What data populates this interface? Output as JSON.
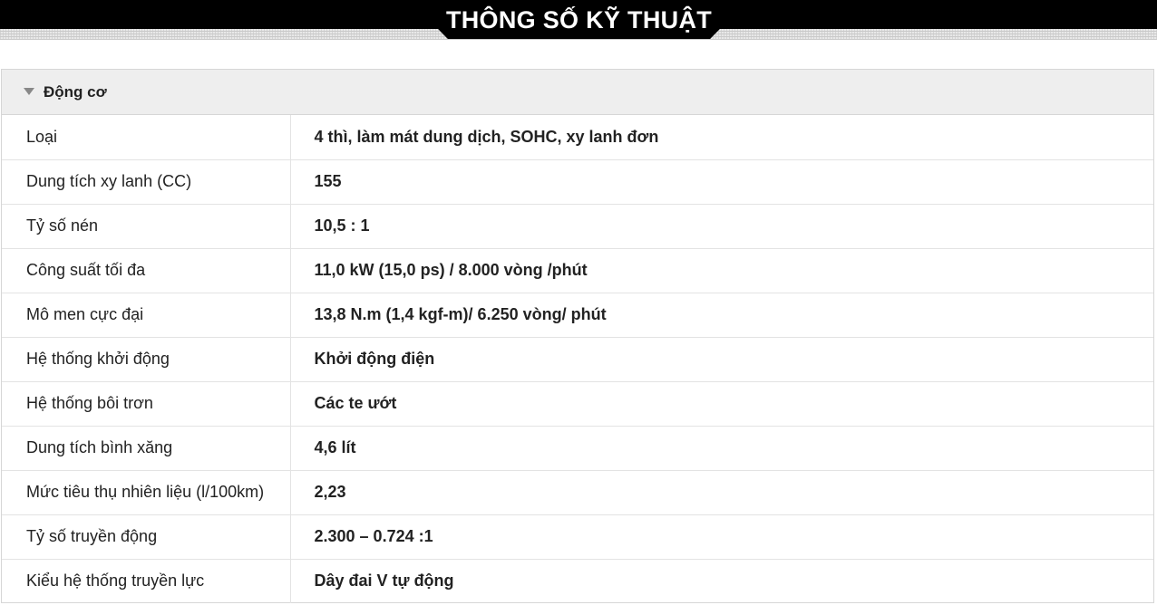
{
  "header": {
    "title": "THÔNG SỐ KỸ THUẬT"
  },
  "section": {
    "title": "Động cơ",
    "expanded": true,
    "toggle_icon": "triangle-down-icon"
  },
  "specs": [
    {
      "label": "Loại",
      "value": "4 thì, làm mát dung dịch, SOHC, xy lanh đơn"
    },
    {
      "label": "Dung tích xy lanh (CC)",
      "value": "155"
    },
    {
      "label": "Tỷ số nén",
      "value": "10,5 : 1"
    },
    {
      "label": "Công suất tối đa",
      "value": "11,0 kW (15,0 ps) / 8.000 vòng /phút"
    },
    {
      "label": "Mô men cực đại",
      "value": "13,8 N.m (1,4 kgf-m)/ 6.250 vòng/ phút"
    },
    {
      "label": "Hệ thống khởi động",
      "value": "Khởi động điện"
    },
    {
      "label": "Hệ thống bôi trơn",
      "value": "Các te ướt"
    },
    {
      "label": "Dung tích bình xăng",
      "value": "4,6 lít"
    },
    {
      "label": "Mức tiêu thụ nhiên liệu (l/100km)",
      "value": "2,23"
    },
    {
      "label": "Tỷ số truyền động",
      "value": "2.300 – 0.724 :1"
    },
    {
      "label": "Kiểu hệ thống truyền lực",
      "value": "Dây đai V tự động"
    }
  ],
  "colors": {
    "header_bg": "#000000",
    "header_text": "#ffffff",
    "section_bg": "#eeeeee",
    "border": "#d6d6d6",
    "text": "#222222"
  }
}
